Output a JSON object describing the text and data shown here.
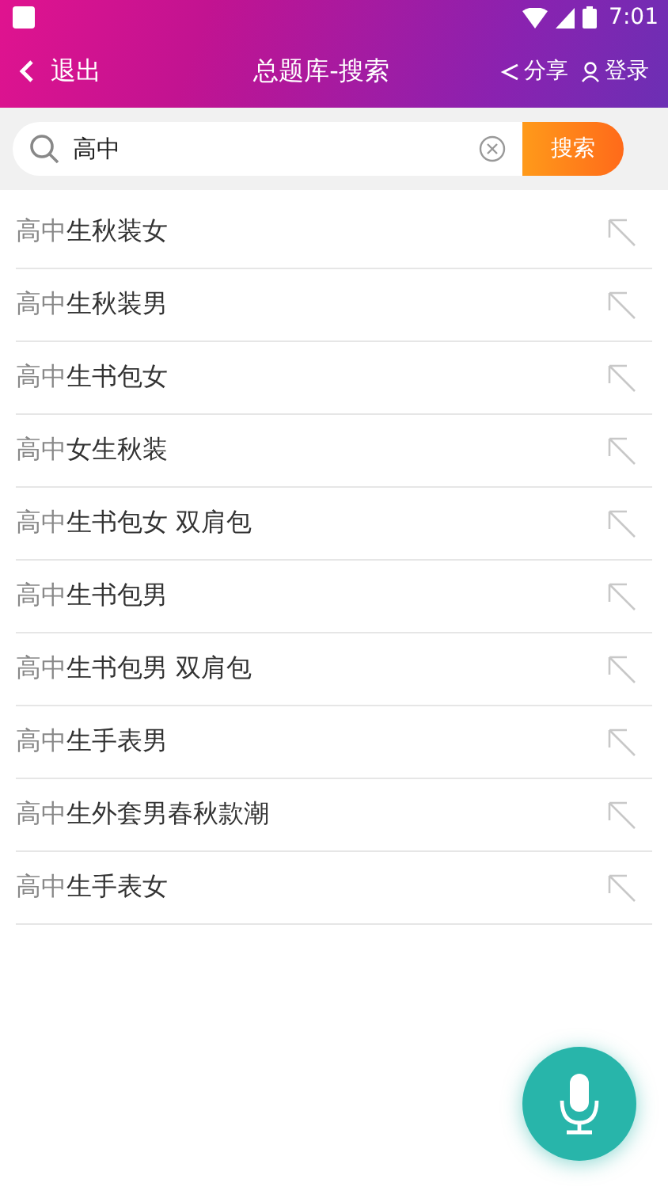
{
  "status_bar": {
    "time": "7:01"
  },
  "header": {
    "back": "退出",
    "title": "总题库-搜索",
    "share": "分享",
    "login": "登录"
  },
  "search": {
    "value": "高中",
    "button": "搜索"
  },
  "suggestions": [
    {
      "match": "高中",
      "rest": "生秋装女"
    },
    {
      "match": "高中",
      "rest": "生秋装男"
    },
    {
      "match": "高中",
      "rest": "生书包女"
    },
    {
      "match": "高中",
      "rest": "女生秋装"
    },
    {
      "match": "高中",
      "rest": "生书包女 双肩包"
    },
    {
      "match": "高中",
      "rest": "生书包男"
    },
    {
      "match": "高中",
      "rest": "生书包男 双肩包"
    },
    {
      "match": "高中",
      "rest": "生手表男"
    },
    {
      "match": "高中",
      "rest": "生外套男春秋款潮"
    },
    {
      "match": "高中",
      "rest": "生手表女"
    }
  ]
}
